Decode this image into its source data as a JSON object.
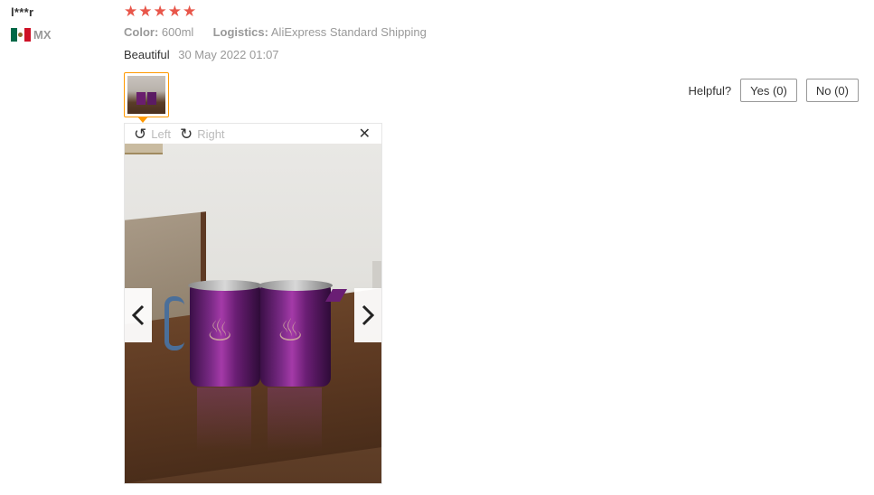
{
  "user": {
    "name": "l***r",
    "country_code": "MX"
  },
  "review": {
    "rating": 5,
    "stars": [
      "★",
      "★",
      "★",
      "★",
      "★"
    ],
    "color_label": "Color:",
    "color_value": "600ml",
    "logistics_label": "Logistics:",
    "logistics_value": "AliExpress Standard Shipping",
    "text": "Beautiful",
    "date": "30 May 2022 01:07"
  },
  "helpful": {
    "label": "Helpful?",
    "yes": "Yes (0)",
    "no": "No (0)"
  },
  "viewer": {
    "rotate_left_label": "Left",
    "rotate_right_label": "Right",
    "close_glyph": "✕",
    "rotate_left_glyph": "↺",
    "rotate_right_glyph": "↻"
  },
  "colors": {
    "star": "#e8564a",
    "thumb_border": "#f90"
  }
}
